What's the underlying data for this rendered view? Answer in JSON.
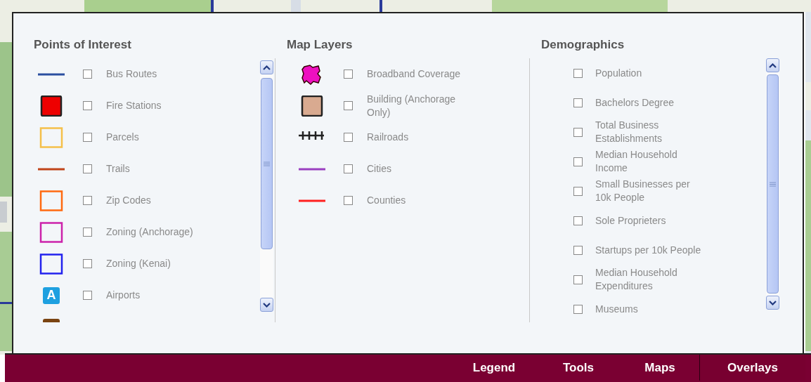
{
  "columns": [
    {
      "title": "Points of Interest",
      "scrollbar": true,
      "items": [
        {
          "label": "Bus Routes",
          "checked": false,
          "symbol": {
            "kind": "line",
            "color": "#2a4fa0"
          }
        },
        {
          "label": "Fire Stations",
          "checked": false,
          "symbol": {
            "kind": "square",
            "color": "#ee0000"
          }
        },
        {
          "label": "Parcels",
          "checked": false,
          "symbol": {
            "kind": "outline",
            "color": "#f5c04a"
          }
        },
        {
          "label": "Trails",
          "checked": false,
          "symbol": {
            "kind": "line",
            "color": "#c0441a"
          }
        },
        {
          "label": "Zip Codes",
          "checked": false,
          "symbol": {
            "kind": "outline",
            "color": "#ff6a10"
          }
        },
        {
          "label": "Zoning (Anchorage)",
          "checked": false,
          "symbol": {
            "kind": "outline",
            "color": "#cc22aa"
          }
        },
        {
          "label": "Zoning (Kenai)",
          "checked": false,
          "symbol": {
            "kind": "outline",
            "color": "#2222ee"
          }
        },
        {
          "label": "Airports",
          "checked": false,
          "symbol": {
            "kind": "badge",
            "color": "#1ea0e0",
            "text": "A"
          }
        },
        {
          "symbol": {
            "kind": "badge",
            "color": "#7a4412"
          }
        }
      ]
    },
    {
      "title": "Map Layers",
      "scrollbar": false,
      "items": [
        {
          "label": "Broadband Coverage",
          "checked": false,
          "symbol": {
            "kind": "blob",
            "color": "#ee10c0"
          }
        },
        {
          "label": "Building (Anchorage Only)",
          "checked": false,
          "symbol": {
            "kind": "square",
            "color": "#d9aa90"
          }
        },
        {
          "label": "Railroads",
          "checked": false,
          "symbol": {
            "kind": "rail",
            "color": "#222222"
          }
        },
        {
          "label": "Cities",
          "checked": false,
          "symbol": {
            "kind": "line",
            "color": "#9a3fc0"
          }
        },
        {
          "label": "Counties",
          "checked": false,
          "symbol": {
            "kind": "line",
            "color": "#ff2020"
          }
        }
      ]
    },
    {
      "title": "Demographics",
      "scrollbar": true,
      "items": [
        {
          "label": "Population",
          "checked": false
        },
        {
          "label": "Bachelors Degree",
          "checked": false
        },
        {
          "label": "Total Business Establishments",
          "checked": false
        },
        {
          "label": "Median Household Income",
          "checked": false
        },
        {
          "label": "Small Businesses per 10k People",
          "checked": false
        },
        {
          "label": "Sole Proprieters",
          "checked": false
        },
        {
          "label": "Startups per 10k People",
          "checked": false
        },
        {
          "label": "Median Household Expenditures",
          "checked": false
        },
        {
          "label": "Museums",
          "checked": false
        }
      ]
    }
  ],
  "nav": [
    {
      "label": "Legend",
      "selected": false
    },
    {
      "label": "Tools",
      "selected": false
    },
    {
      "label": "Maps",
      "selected": false
    },
    {
      "label": "Overlays",
      "selected": true
    }
  ]
}
